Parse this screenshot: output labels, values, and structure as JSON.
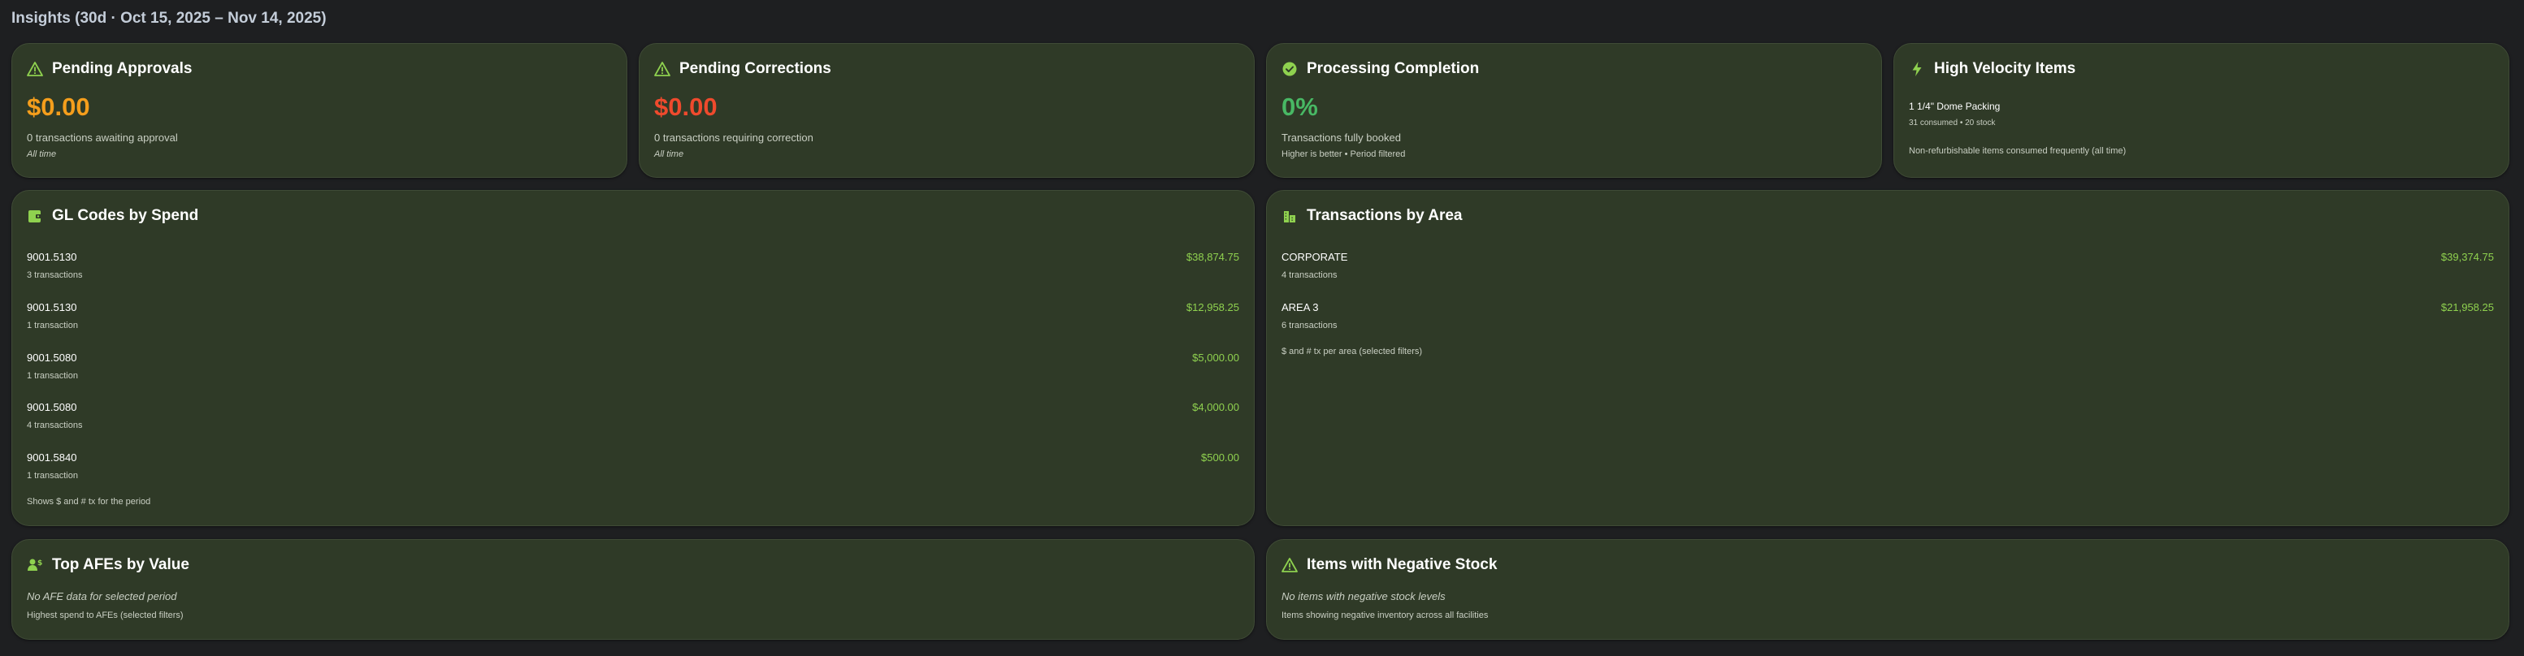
{
  "header": {
    "title": "Insights (30d · Oct 15, 2025 – Nov 14, 2025)"
  },
  "colors": {
    "accent": "#8fd14f",
    "warning": "#f59e1c",
    "danger": "#ef4a2d",
    "success": "#48b864",
    "card_bg": "#2f3a27"
  },
  "pending_approvals": {
    "icon": "warning-triangle-icon",
    "title": "Pending Approvals",
    "value": "$0.00",
    "description": "0 transactions awaiting approval",
    "note": "All time"
  },
  "pending_corrections": {
    "icon": "warning-triangle-icon",
    "title": "Pending Corrections",
    "value": "$0.00",
    "description": "0 transactions requiring correction",
    "note": "All time"
  },
  "processing_completion": {
    "icon": "check-circle-icon",
    "title": "Processing Completion",
    "value": "0%",
    "description": "Transactions fully booked",
    "note": "Higher is better • Period filtered"
  },
  "high_velocity": {
    "icon": "lightning-bolt-icon",
    "title": "High Velocity Items",
    "item_name": "1 1/4\" Dome Packing",
    "item_detail": "31 consumed • 20 stock",
    "note": "Non-refurbishable items consumed frequently (all time)"
  },
  "gl_codes": {
    "icon": "wallet-icon",
    "title": "GL Codes by Spend",
    "rows": [
      {
        "code": "9001.5130",
        "count": "3 transactions",
        "amount": "$38,874.75"
      },
      {
        "code": "9001.5130",
        "count": "1 transaction",
        "amount": "$12,958.25"
      },
      {
        "code": "9001.5080",
        "count": "1 transaction",
        "amount": "$5,000.00"
      },
      {
        "code": "9001.5080",
        "count": "4 transactions",
        "amount": "$4,000.00"
      },
      {
        "code": "9001.5840",
        "count": "1 transaction",
        "amount": "$500.00"
      }
    ],
    "footer": "Shows $ and # tx for the period"
  },
  "areas": {
    "icon": "building-icon",
    "title": "Transactions by Area",
    "rows": [
      {
        "code": "CORPORATE",
        "count": "4 transactions",
        "amount": "$39,374.75"
      },
      {
        "code": "AREA 3",
        "count": "6 transactions",
        "amount": "$21,958.25"
      }
    ],
    "footer": "$ and # tx per area (selected filters)"
  },
  "top_afes": {
    "icon": "user-money-icon",
    "title": "Top AFEs by Value",
    "empty": "No AFE data for selected period",
    "footer": "Highest spend to AFEs (selected filters)"
  },
  "negative_stock": {
    "icon": "warning-triangle-icon",
    "title": "Items with Negative Stock",
    "empty": "No items with negative stock levels",
    "footer": "Items showing negative inventory across all facilities"
  }
}
